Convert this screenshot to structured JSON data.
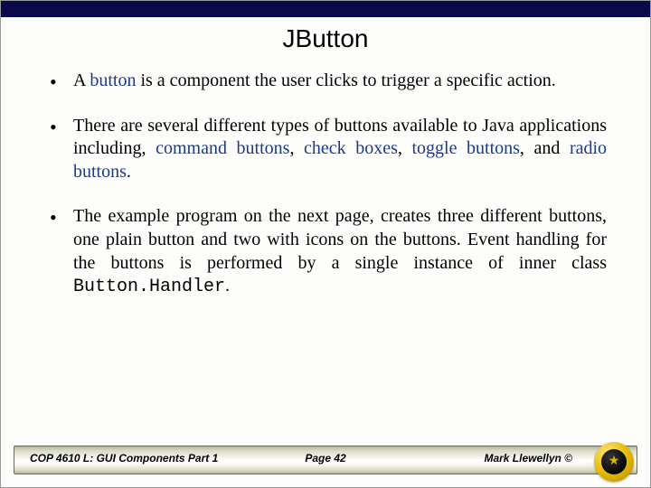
{
  "title": "JButton",
  "bullets": [
    {
      "pre": "A ",
      "term1": "button",
      "post1": " is a component the user clicks to trigger a specific action."
    },
    {
      "pre": "There are several different types of buttons available to Java applications including, ",
      "term1": "command buttons",
      "mid1": ", ",
      "term2": "check boxes",
      "mid2": ", ",
      "term3": "toggle buttons",
      "mid3": ", and ",
      "term4": "radio buttons",
      "post": "."
    },
    {
      "pre": "The example program on the next page, creates three different buttons, one plain button and two with icons on the buttons.  Event handling for the buttons is performed by a single instance of inner class ",
      "code": "Button.Handler",
      "post": "."
    }
  ],
  "footer": {
    "left": "COP 4610 L: GUI Components Part 1",
    "center": "Page 42",
    "right": "Mark Llewellyn ©"
  }
}
